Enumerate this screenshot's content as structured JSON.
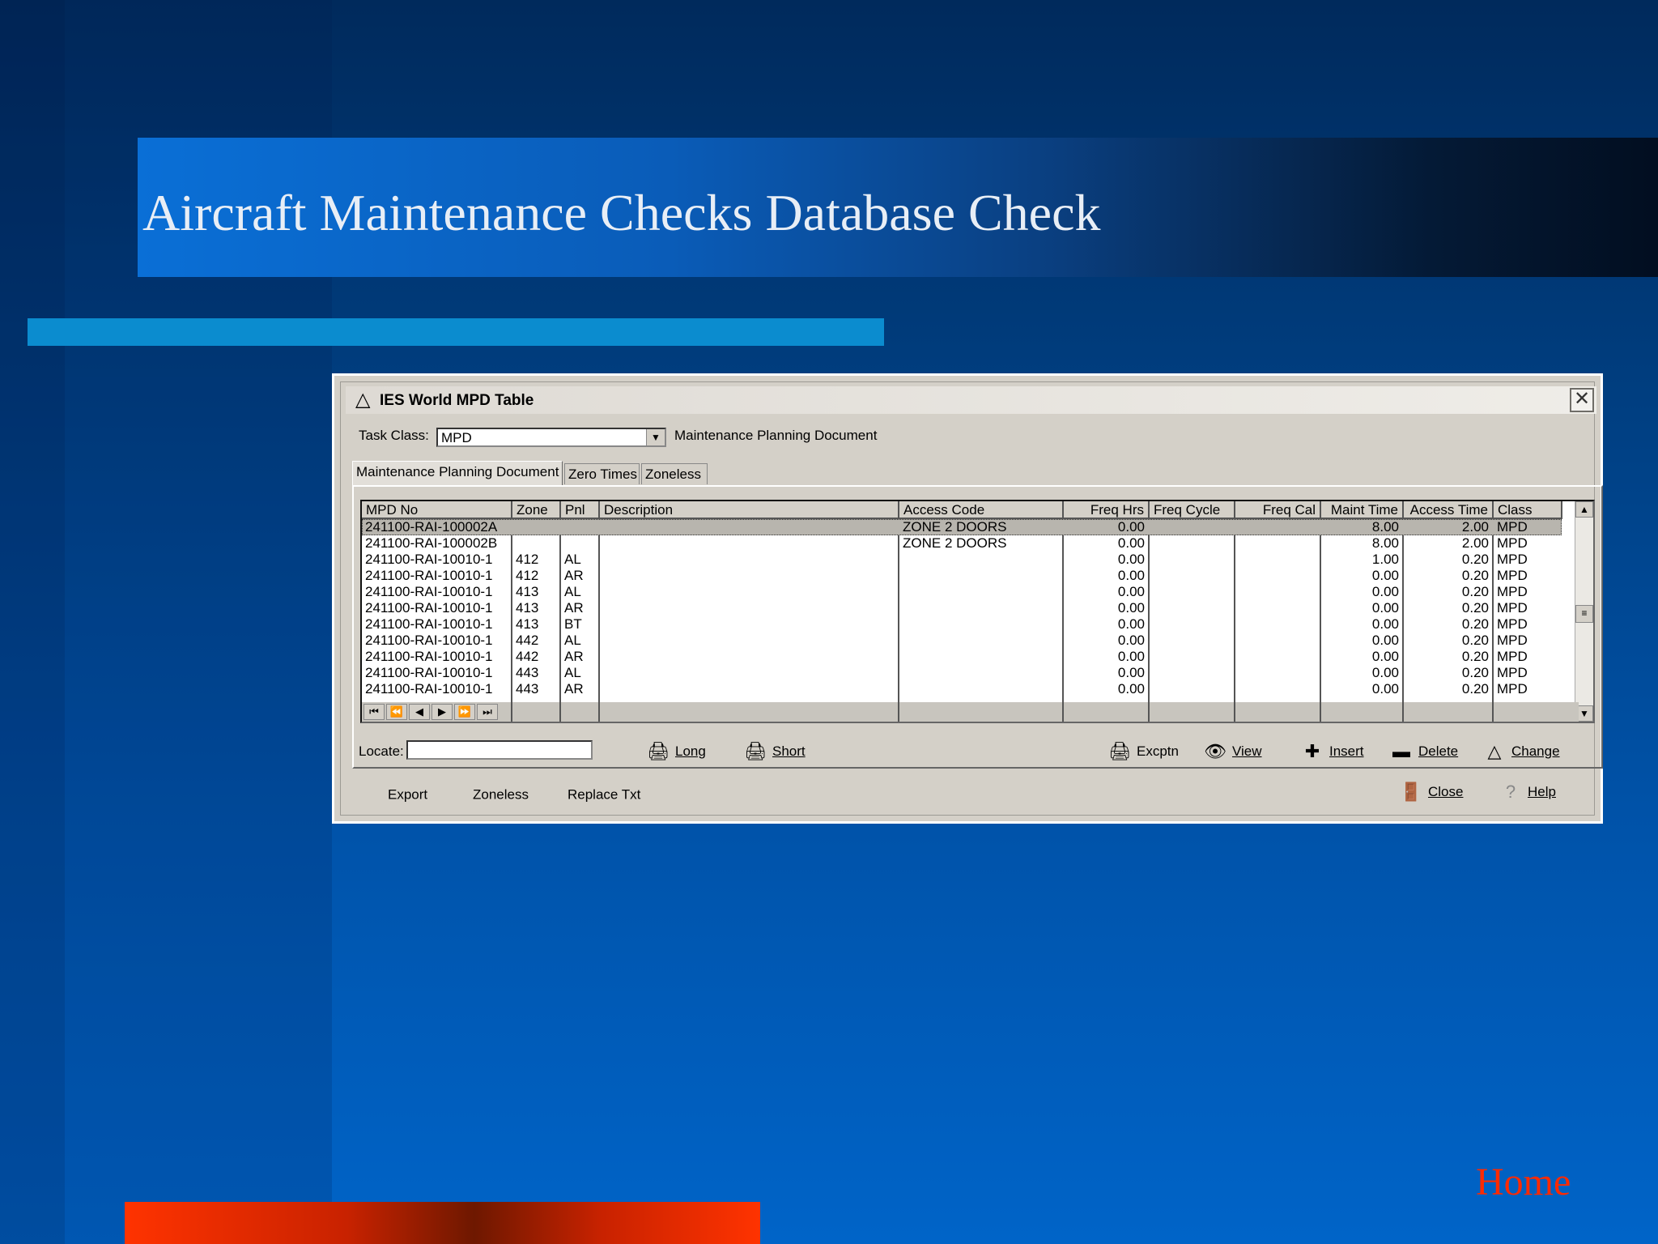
{
  "slide": {
    "title": "Aircraft Maintenance Checks Database Check",
    "home_label": "Home"
  },
  "window": {
    "title": "IES World MPD Table",
    "task_class_label": "Task Class:",
    "task_class_value": "MPD",
    "task_class_description": "Maintenance Planning Document",
    "tabs": [
      {
        "label": "Maintenance Planning Document"
      },
      {
        "label": "Zero Times"
      },
      {
        "label": "Zoneless"
      }
    ],
    "columns": [
      "MPD No",
      "Zone",
      "Pnl",
      "Description",
      "Access Code",
      "Freq Hrs",
      "Freq Cycle",
      "Freq Cal",
      "Maint Time",
      "Access Time",
      "Class"
    ],
    "rows": [
      {
        "mpd_no": "241100-RAI-100002A",
        "zone": "",
        "pnl": "",
        "access_code": "ZONE 2 DOORS",
        "freq_hrs": "0.00",
        "maint_time": "8.00",
        "access_time": "2.00",
        "class": "MPD"
      },
      {
        "mpd_no": "241100-RAI-100002B",
        "zone": "",
        "pnl": "",
        "access_code": "ZONE 2 DOORS",
        "freq_hrs": "0.00",
        "maint_time": "8.00",
        "access_time": "2.00",
        "class": "MPD"
      },
      {
        "mpd_no": "241100-RAI-10010-1",
        "zone": "412",
        "pnl": "AL",
        "access_code": "",
        "freq_hrs": "0.00",
        "maint_time": "1.00",
        "access_time": "0.20",
        "class": "MPD"
      },
      {
        "mpd_no": "241100-RAI-10010-1",
        "zone": "412",
        "pnl": "AR",
        "access_code": "",
        "freq_hrs": "0.00",
        "maint_time": "0.00",
        "access_time": "0.20",
        "class": "MPD"
      },
      {
        "mpd_no": "241100-RAI-10010-1",
        "zone": "413",
        "pnl": "AL",
        "access_code": "",
        "freq_hrs": "0.00",
        "maint_time": "0.00",
        "access_time": "0.20",
        "class": "MPD"
      },
      {
        "mpd_no": "241100-RAI-10010-1",
        "zone": "413",
        "pnl": "AR",
        "access_code": "",
        "freq_hrs": "0.00",
        "maint_time": "0.00",
        "access_time": "0.20",
        "class": "MPD"
      },
      {
        "mpd_no": "241100-RAI-10010-1",
        "zone": "413",
        "pnl": "BT",
        "access_code": "",
        "freq_hrs": "0.00",
        "maint_time": "0.00",
        "access_time": "0.20",
        "class": "MPD"
      },
      {
        "mpd_no": "241100-RAI-10010-1",
        "zone": "442",
        "pnl": "AL",
        "access_code": "",
        "freq_hrs": "0.00",
        "maint_time": "0.00",
        "access_time": "0.20",
        "class": "MPD"
      },
      {
        "mpd_no": "241100-RAI-10010-1",
        "zone": "442",
        "pnl": "AR",
        "access_code": "",
        "freq_hrs": "0.00",
        "maint_time": "0.00",
        "access_time": "0.20",
        "class": "MPD"
      },
      {
        "mpd_no": "241100-RAI-10010-1",
        "zone": "443",
        "pnl": "AL",
        "access_code": "",
        "freq_hrs": "0.00",
        "maint_time": "0.00",
        "access_time": "0.20",
        "class": "MPD"
      },
      {
        "mpd_no": "241100-RAI-10010-1",
        "zone": "443",
        "pnl": "AR",
        "access_code": "",
        "freq_hrs": "0.00",
        "maint_time": "0.00",
        "access_time": "0.20",
        "class": "MPD"
      }
    ],
    "locate_label": "Locate:",
    "locate_value": "",
    "actions": {
      "long": "Long",
      "short": "Short",
      "excptn": "Excptn",
      "view": "View",
      "insert": "Insert",
      "delete": "Delete",
      "change": "Change"
    },
    "footer": {
      "export": "Export",
      "zoneless": "Zoneless",
      "replace_txt": "Replace Txt",
      "close": "Close",
      "help": "Help"
    }
  }
}
